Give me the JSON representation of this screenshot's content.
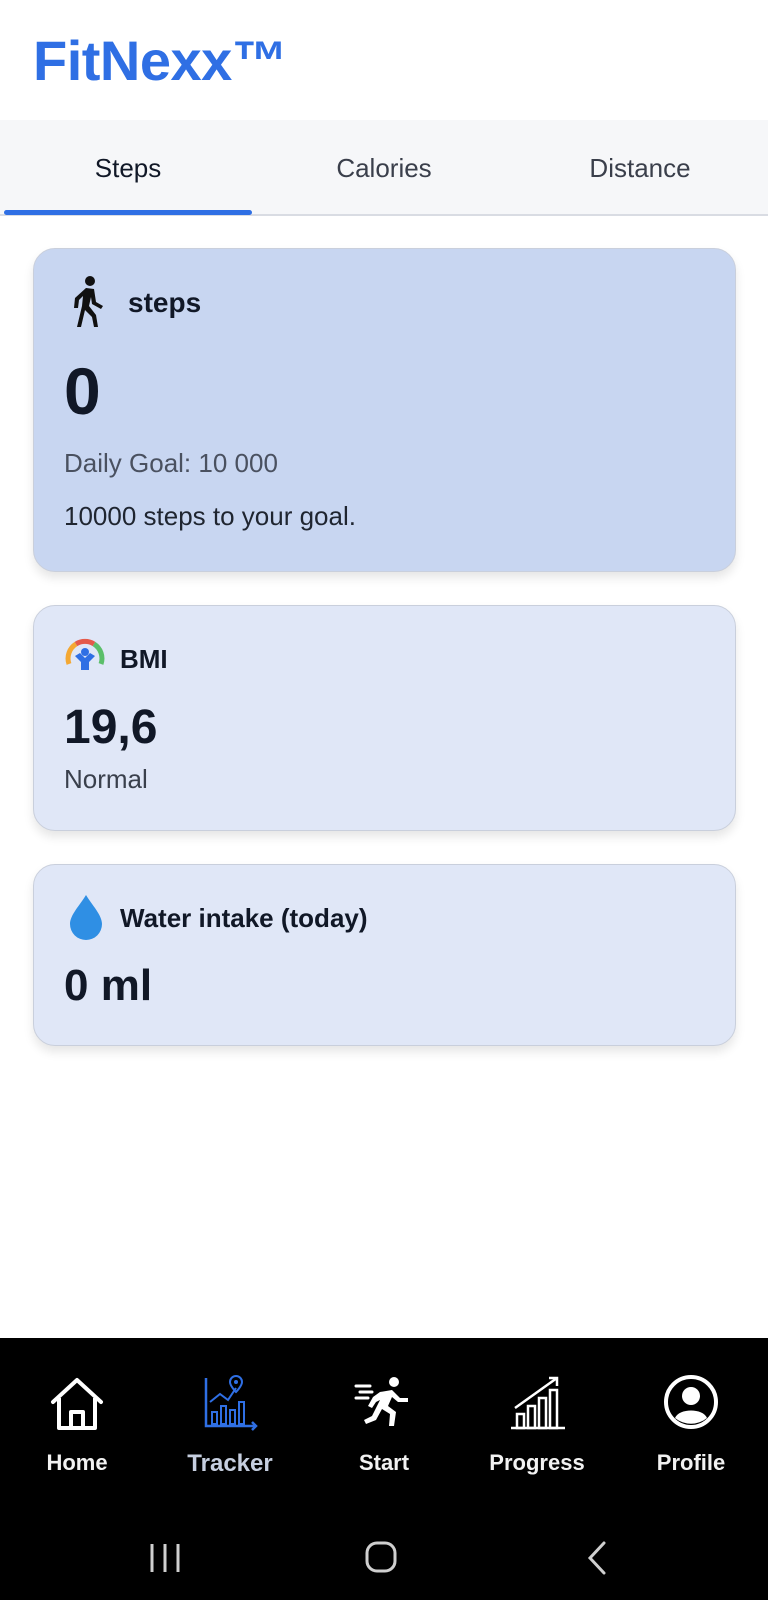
{
  "app": {
    "brand": "FitNexx™"
  },
  "tabs": [
    {
      "label": "Steps",
      "active": true
    },
    {
      "label": "Calories",
      "active": false
    },
    {
      "label": "Distance",
      "active": false
    }
  ],
  "steps_card": {
    "icon": "walking-person-icon",
    "title": "steps",
    "value": "0",
    "goal": "Daily Goal: 10 000",
    "remaining": "10000 steps to your goal."
  },
  "bmi_card": {
    "icon": "bmi-gauge-icon",
    "title": "BMI",
    "value": "19,6",
    "status": "Normal"
  },
  "water_card": {
    "icon": "water-drop-icon",
    "title": "Water intake (today)",
    "value": "0 ml"
  },
  "nav": {
    "items": [
      {
        "label": "Home",
        "icon": "home-icon",
        "active": false
      },
      {
        "label": "Tracker",
        "icon": "tracker-chart-icon",
        "active": true
      },
      {
        "label": "Start",
        "icon": "running-person-icon",
        "active": false
      },
      {
        "label": "Progress",
        "icon": "bar-chart-icon",
        "active": false
      },
      {
        "label": "Profile",
        "icon": "user-circle-icon",
        "active": false
      }
    ]
  },
  "system_bar": {
    "buttons": [
      "recent-apps-icon",
      "home-button-icon",
      "back-icon"
    ]
  },
  "colors": {
    "brand": "#2f6fe4",
    "tab_indicator": "#2f6fe4",
    "steps_card_bg": "#c8d6f1",
    "card_bg": "#e0e7f7",
    "nav_bg": "#000000",
    "water_drop": "#2f8fe4"
  }
}
